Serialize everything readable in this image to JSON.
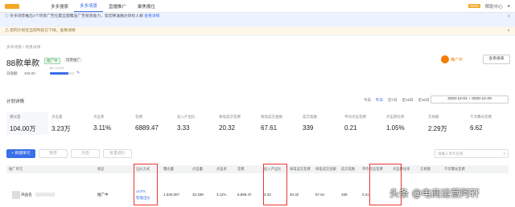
{
  "nav": {
    "tabs": [
      "多多搜索",
      "多多场景",
      "直播推广",
      "聚焦展位"
    ],
    "active_index": 1,
    "right_items": [
      "帮助中心"
    ],
    "right_badge": "NEW"
  },
  "notice1": {
    "text": "多多场景推出4个场景广告位置全面覆盖广告投放能力，帮您精准触达目标人群",
    "link": "查看详情"
  },
  "notice2": {
    "text": "您的计划在当前时段已下线，查看详情",
    "link": "查看详情"
  },
  "breadcrumb": "多多场景 / 场景详情",
  "plan": {
    "title": "88款单款",
    "tag_status": "推广中",
    "tag_type": "场景推广",
    "budget_label": "日限额",
    "budget_value": "400.00",
    "progress_caption": "Bu: 12.5%",
    "progress_fraction": 0.78,
    "edit_icon": "edit-icon",
    "status_label": "推广中",
    "report_button": "查看报表"
  },
  "stats_section": {
    "title": "计划详情",
    "time_tabs": [
      "今日",
      "昨日",
      "近7日",
      "近15日",
      "近30日"
    ],
    "active_time_tab": 1,
    "date_range": "2020-12-01 ~ 2020-12-29"
  },
  "stats": [
    {
      "label": "曝光量",
      "value": "104.00万"
    },
    {
      "label": "点击量",
      "value": "3.23万"
    },
    {
      "label": "点击率",
      "value": "3.11%"
    },
    {
      "label": "花费",
      "value": "6889.47"
    },
    {
      "label": "投入产出比",
      "value": "3.33"
    },
    {
      "label": "每笔成交花费",
      "value": "20.32"
    },
    {
      "label": "每笔成交金额",
      "value": "67.61"
    },
    {
      "label": "成交笔数",
      "value": "339"
    },
    {
      "label": "平均点击花费",
      "value": "0.21"
    },
    {
      "label": "点击转化率",
      "value": "1.05%"
    },
    {
      "label": "交易额",
      "value": "2.29万"
    },
    {
      "label": "千次曝光花费",
      "value": "6.62"
    }
  ],
  "toolbar": {
    "new_button": "+ 新建单元",
    "btn_pause": "暂停",
    "btn_start": "开启",
    "btn_bid": "批量调价",
    "search_placeholder": "请输入单元名称"
  },
  "table": {
    "headers": [
      "推广单元",
      "状态",
      "出价方式",
      "曝光量",
      "点击量",
      "点击率",
      "花费",
      "投入产出比",
      "每笔成交花费",
      "每笔成交金额",
      "成交笔数",
      "平均点击花费",
      "点击转化率",
      "交易额",
      "千次曝光花费"
    ],
    "row": {
      "name": "商品名",
      "status": "推广中",
      "bid_method": "oCPX",
      "bid_extra": "智能出价",
      "impressions": "1,040,007",
      "clicks": "32,339",
      "ctr": "3.11%",
      "spend": "6,889.47",
      "roi": "3.33",
      "cost_per_order": "20.32",
      "order_amount": "67.61",
      "orders": "339",
      "cpc": "0.21",
      "cvr": "",
      "gmv": "",
      "cpm": ""
    }
  },
  "watermark": "头条 @电商运营阿轩"
}
